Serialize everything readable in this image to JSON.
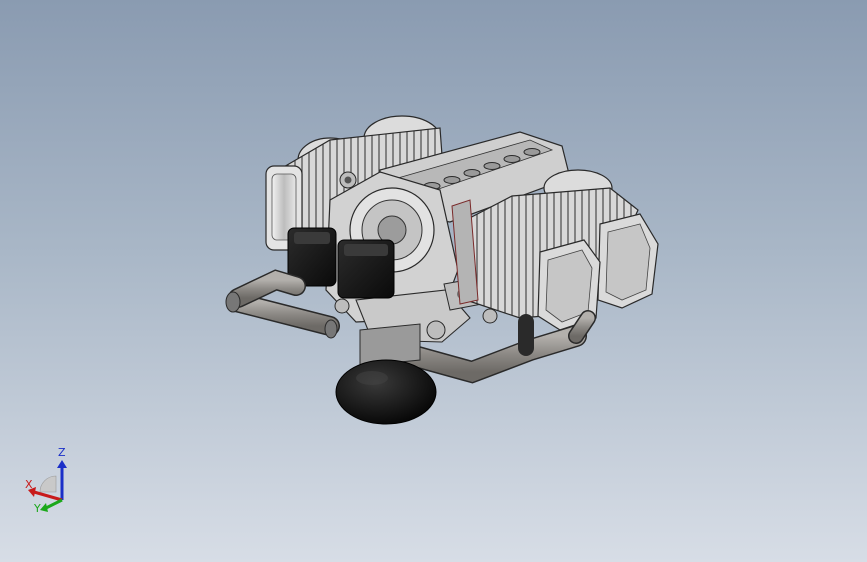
{
  "viewport": {
    "background_top": "#8a9bb1",
    "background_bottom": "#d7dde6",
    "model_name": "flat-four-engine-assembly"
  },
  "triad": {
    "z_label": "Z",
    "x_label": "X",
    "y_label": "Y",
    "z_color": "#1a2fc8",
    "x_color": "#c81a1a",
    "y_color": "#1aa81a"
  },
  "colors": {
    "cylinder": "#d6d6d6",
    "cylinder_dark": "#9c9c9c",
    "pipe": "#8f8c88",
    "coil": "#161616",
    "sump": "#0d0d0d",
    "outline": "#2a2a2a"
  }
}
